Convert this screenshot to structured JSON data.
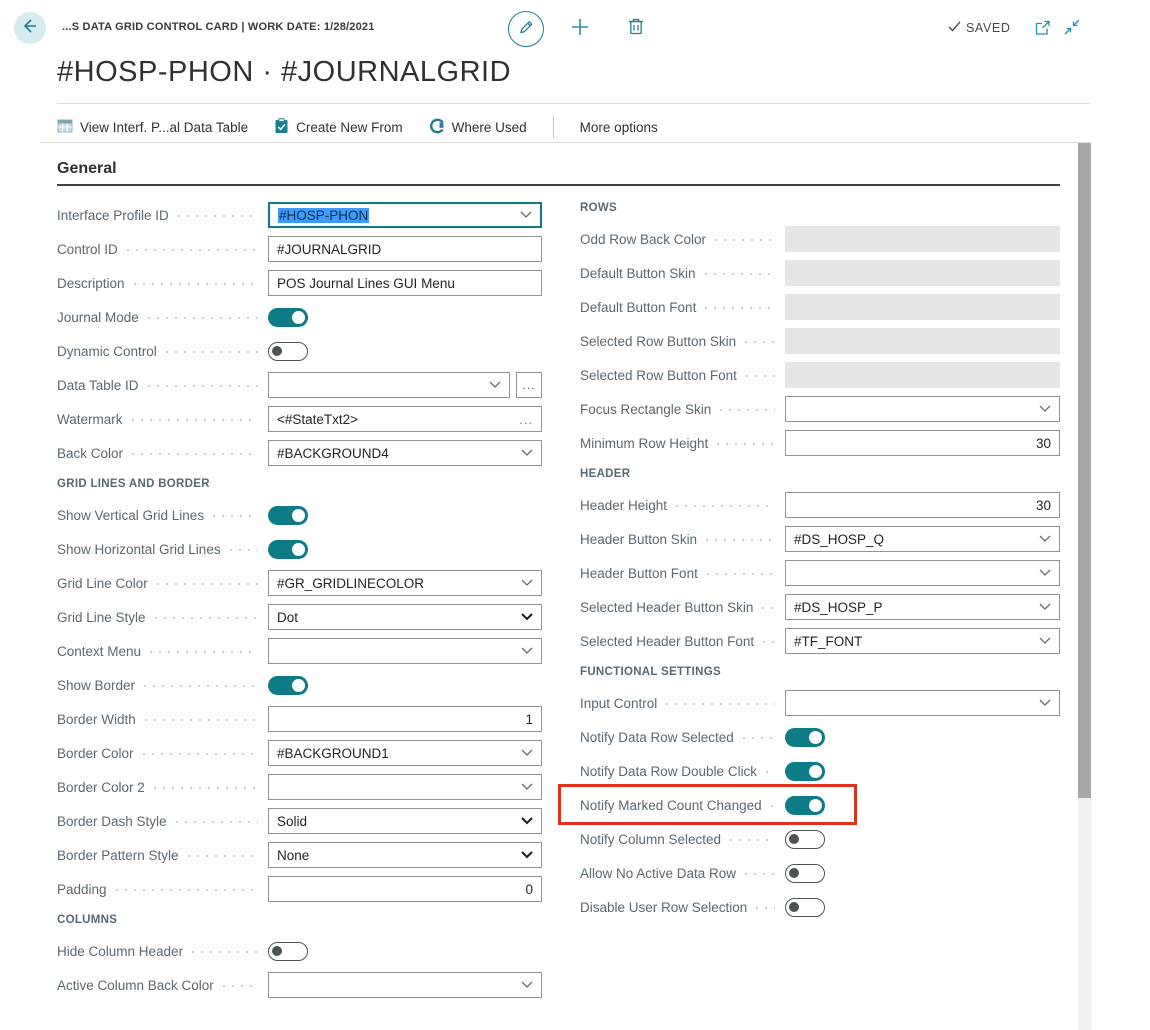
{
  "header": {
    "caption": "...S DATA GRID CONTROL CARD | WORK DATE: 1/28/2021",
    "title": "#HOSP-PHON · #JOURNALGRID",
    "saved_label": "SAVED"
  },
  "action_bar": {
    "items": [
      {
        "label": "View Interf. P...al Data Table",
        "icon": "table-icon"
      },
      {
        "label": "Create New From",
        "icon": "clipboard-check-icon"
      },
      {
        "label": "Where Used",
        "icon": "where-used-icon"
      }
    ],
    "more_options_label": "More options"
  },
  "section": {
    "title": "General"
  },
  "left_column": {
    "rows": [
      {
        "type": "lookup",
        "label": "Interface Profile ID",
        "value": "#HOSP-PHON",
        "focused": true,
        "selected_text": true
      },
      {
        "type": "input",
        "label": "Control ID",
        "value": "#JOURNALGRID"
      },
      {
        "type": "input",
        "label": "Description",
        "value": "POS Journal Lines GUI Menu"
      },
      {
        "type": "toggle",
        "label": "Journal Mode",
        "on": true
      },
      {
        "type": "toggle",
        "label": "Dynamic Control",
        "on": false
      },
      {
        "type": "lookup",
        "label": "Data Table ID",
        "value": "",
        "assist": true
      },
      {
        "type": "input",
        "label": "Watermark",
        "value": "<#StateTxt2>",
        "ellipsis": true
      },
      {
        "type": "lookup",
        "label": "Back Color",
        "value": "#BACKGROUND4"
      },
      {
        "type": "subheader",
        "label": "GRID LINES AND BORDER"
      },
      {
        "type": "toggle",
        "label": "Show Vertical Grid Lines",
        "on": true
      },
      {
        "type": "toggle",
        "label": "Show Horizontal Grid Lines",
        "on": true
      },
      {
        "type": "lookup",
        "label": "Grid Line Color",
        "value": "#GR_GRIDLINECOLOR"
      },
      {
        "type": "select",
        "label": "Grid Line Style",
        "value": "Dot"
      },
      {
        "type": "lookup",
        "label": "Context Menu",
        "value": ""
      },
      {
        "type": "toggle",
        "label": "Show Border",
        "on": true
      },
      {
        "type": "input",
        "label": "Border Width",
        "value": "1",
        "align": "right"
      },
      {
        "type": "lookup",
        "label": "Border Color",
        "value": "#BACKGROUND1"
      },
      {
        "type": "lookup",
        "label": "Border Color 2",
        "value": ""
      },
      {
        "type": "select",
        "label": "Border Dash Style",
        "value": "Solid"
      },
      {
        "type": "select",
        "label": "Border Pattern Style",
        "value": "None"
      },
      {
        "type": "input",
        "label": "Padding",
        "value": "0",
        "align": "right"
      },
      {
        "type": "subheader",
        "label": "COLUMNS"
      },
      {
        "type": "toggle",
        "label": "Hide Column Header",
        "on": false
      },
      {
        "type": "lookup",
        "label": "Active Column Back Color",
        "value": ""
      }
    ]
  },
  "right_column": {
    "rows": [
      {
        "type": "subheader",
        "label": "ROWS"
      },
      {
        "type": "disabled",
        "label": "Odd Row Back Color"
      },
      {
        "type": "disabled",
        "label": "Default Button Skin"
      },
      {
        "type": "disabled",
        "label": "Default Button Font"
      },
      {
        "type": "disabled",
        "label": "Selected Row Button Skin"
      },
      {
        "type": "disabled",
        "label": "Selected Row Button Font"
      },
      {
        "type": "lookup",
        "label": "Focus Rectangle Skin",
        "value": ""
      },
      {
        "type": "input",
        "label": "Minimum Row Height",
        "value": "30",
        "align": "right"
      },
      {
        "type": "subheader",
        "label": "HEADER"
      },
      {
        "type": "input",
        "label": "Header Height",
        "value": "30",
        "align": "right"
      },
      {
        "type": "lookup",
        "label": "Header Button Skin",
        "value": "#DS_HOSP_Q"
      },
      {
        "type": "lookup",
        "label": "Header Button Font",
        "value": ""
      },
      {
        "type": "lookup",
        "label": "Selected Header Button Skin",
        "value": "#DS_HOSP_P"
      },
      {
        "type": "lookup",
        "label": "Selected Header Button Font",
        "value": "#TF_FONT"
      },
      {
        "type": "subheader",
        "label": "FUNCTIONAL SETTINGS"
      },
      {
        "type": "lookup",
        "label": "Input Control",
        "value": ""
      },
      {
        "type": "toggle",
        "label": "Notify Data Row Selected",
        "on": true
      },
      {
        "type": "toggle",
        "label": "Notify Data Row Double Click",
        "on": true
      },
      {
        "type": "toggle",
        "label": "Notify Marked Count Changed",
        "on": true,
        "highlighted": true
      },
      {
        "type": "toggle",
        "label": "Notify Column Selected",
        "on": false
      },
      {
        "type": "toggle",
        "label": "Allow No Active Data Row",
        "on": false
      },
      {
        "type": "toggle",
        "label": "Disable User Row Selection",
        "on": false
      }
    ]
  },
  "colors": {
    "accent_teal": "#0e7c86",
    "icon_teal": "#1a7f8e",
    "highlight_red": "#e0301e",
    "selection_blue": "#3f9cfb",
    "disabled_field": "#e6e6e6",
    "label_gray": "#5a6872"
  }
}
